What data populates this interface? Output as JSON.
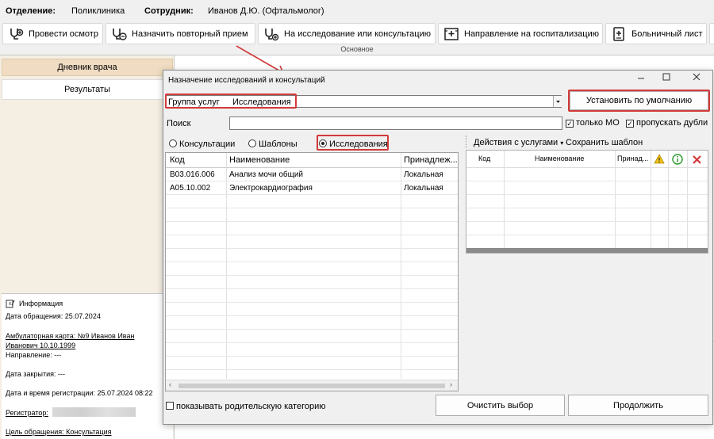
{
  "topbar": {
    "dept_label": "Отделение:",
    "dept_value": "Поликлиника",
    "staff_label": "Сотрудник:",
    "staff_value": "Иванов Д.Ю. (Офтальмолог)"
  },
  "toolbar": {
    "buttons": [
      {
        "label": "Провести осмотр",
        "icon": "stethoscope-plus-icon"
      },
      {
        "label": "Назначить повторный прием",
        "icon": "stethoscope-refresh-icon"
      },
      {
        "label": "На исследование или консультацию",
        "icon": "stethoscope-research-icon"
      },
      {
        "label": "Направление на госпитализацию",
        "icon": "hospital-referral-icon"
      },
      {
        "label": "Больничный лист",
        "icon": "sick-leave-icon"
      }
    ],
    "group_label": "Основное"
  },
  "sidebar": {
    "diary": "Дневник врача",
    "results": "Результаты"
  },
  "info": {
    "header": "Информация",
    "date_appeal": "Дата обращения: 25.07.2024",
    "card_line1": "Амбулаторная карта: №9 Иванов Иван",
    "card_line2": "Иванович 10.10.1999",
    "direction": "Направление: ---",
    "close_date": "Дата закрытия: ---",
    "reg_datetime": "Дата и время регистрации: 25.07.2024 08:22",
    "registrar": "Регистратор:",
    "purpose": "Цель обращения: Консультация"
  },
  "dialog": {
    "title": "Назначение исследований и консультаций",
    "group_label": "Группа услуг",
    "group_value": "Исследования",
    "default_button": "Установить по умолчанию",
    "search_label": "Поиск",
    "search_value": "",
    "only_mo": "только МО",
    "skip_dups": "пропускать дубли",
    "radios": [
      "Консультации",
      "Шаблоны",
      "Исследования"
    ],
    "selected_radio": "Исследования",
    "left_table": {
      "columns": [
        "Код",
        "Наименование",
        "Принадлеж..."
      ],
      "rows": [
        [
          "B03.016.006",
          "Анализ мочи общий",
          "Локальная"
        ],
        [
          "A05.10.002",
          "Электрокардиография",
          "Локальная"
        ]
      ]
    },
    "actions_menu": "Действия с услугами",
    "save_template": "Сохранить шаблон",
    "right_table": {
      "columns": [
        "Код",
        "Наименование",
        "Принад..."
      ]
    },
    "show_parent": "показывать родительскую категорию",
    "clear_button": "Очистить выбор",
    "continue_button": "Продолжить",
    "accent_red": "#d23a3a"
  }
}
